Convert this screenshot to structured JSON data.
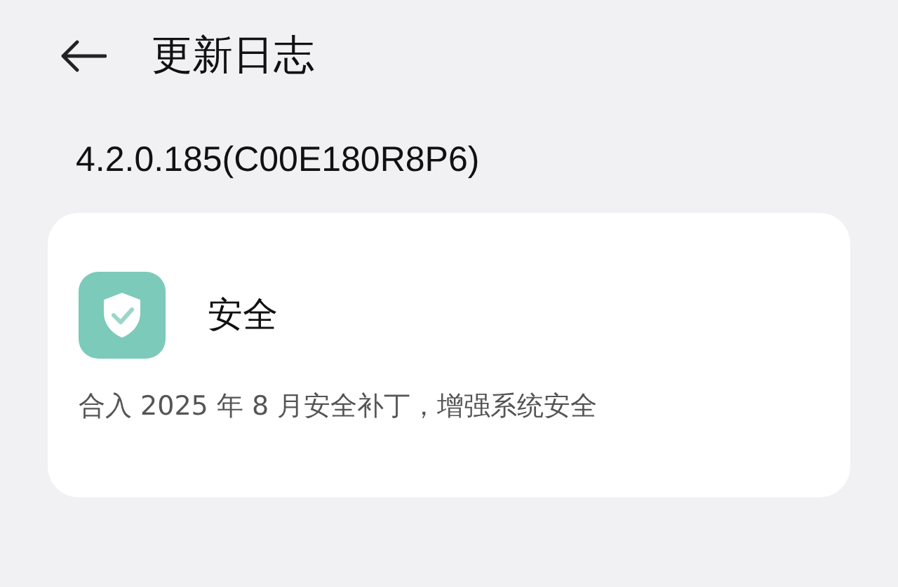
{
  "header": {
    "title": "更新日志"
  },
  "version": "4.2.0.185(C00E180R8P6)",
  "entries": [
    {
      "category": "安全",
      "description": "合入 2025 年 8 月安全补丁，增强系统安全"
    }
  ]
}
